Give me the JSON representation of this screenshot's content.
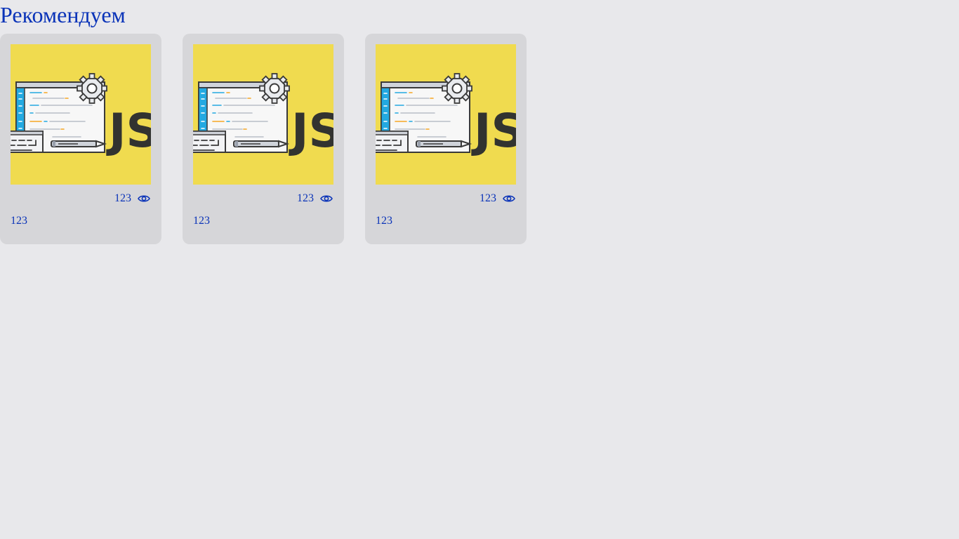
{
  "section": {
    "title": "Рекомендуем"
  },
  "cards": [
    {
      "image_icon": "javascript-illustration",
      "views": "123",
      "title": "123"
    },
    {
      "image_icon": "javascript-illustration",
      "views": "123",
      "title": "123"
    },
    {
      "image_icon": "javascript-illustration",
      "views": "123",
      "title": "123"
    }
  ],
  "colors": {
    "background": "#e8e8eb",
    "card": "#d6d6d9",
    "accent": "#0a33b8",
    "js_yellow": "#f0db4f"
  },
  "icons": {
    "views": "eye-icon"
  }
}
